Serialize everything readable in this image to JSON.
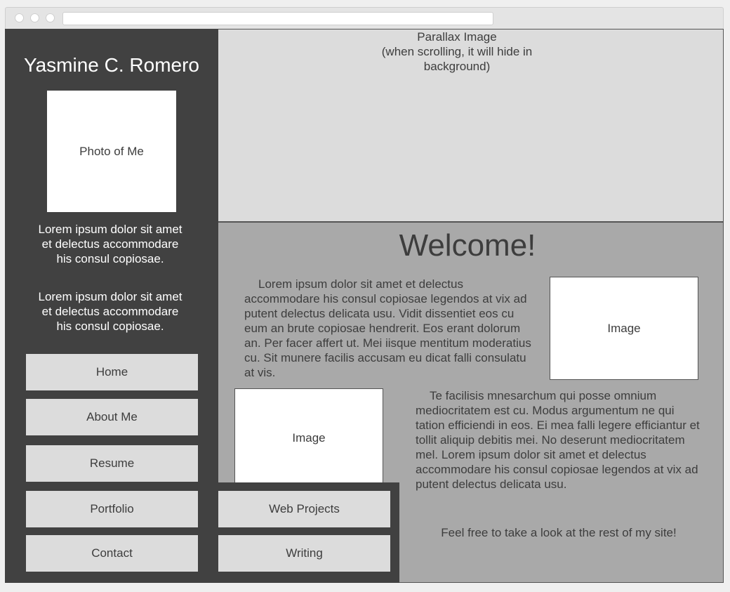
{
  "sidebar": {
    "name": "Yasmine C. Romero",
    "photo_label": "Photo of Me",
    "bio": [
      "Lorem ipsum dolor sit amet et delectus accommodare his consul copiosae.",
      "Lorem ipsum dolor sit amet et delectus accommodare his consul copiosae."
    ],
    "nav": [
      "Home",
      "About Me",
      "Resume",
      "Portfolio",
      "Contact"
    ]
  },
  "submenu": [
    "Web Projects",
    "Writing"
  ],
  "parallax": {
    "label": "Parallax Image\n(when scrolling, it will hide in\nbackground)"
  },
  "main": {
    "heading": "Welcome!",
    "para1": "Lorem ipsum dolor sit amet et delectus accommodare his consul copiosae legendos at vix ad putent delectus delicata usu. Vidit dissentiet eos cu eum an brute copiosae hendrerit. Eos erant dolorum an. Per facer affert ut. Mei iisque mentitum moderatius cu. Sit munere facilis accusam eu dicat falli consulatu at vis.",
    "para2": "Te facilisis mnesarchum qui posse omnium mediocritatem est cu. Modus argumentum ne qui tation efficiendi in eos. Ei mea falli legere efficiantur et tollit aliquip debitis mei. No deserunt mediocritatem mel. Lorem ipsum dolor sit amet et delectus accommodare his consul copiosae legendos at vix ad putent delectus delicata usu.",
    "image1_label": "Image",
    "image2_label": "Image",
    "closing": "Feel free to take a look at the rest of my site!"
  }
}
